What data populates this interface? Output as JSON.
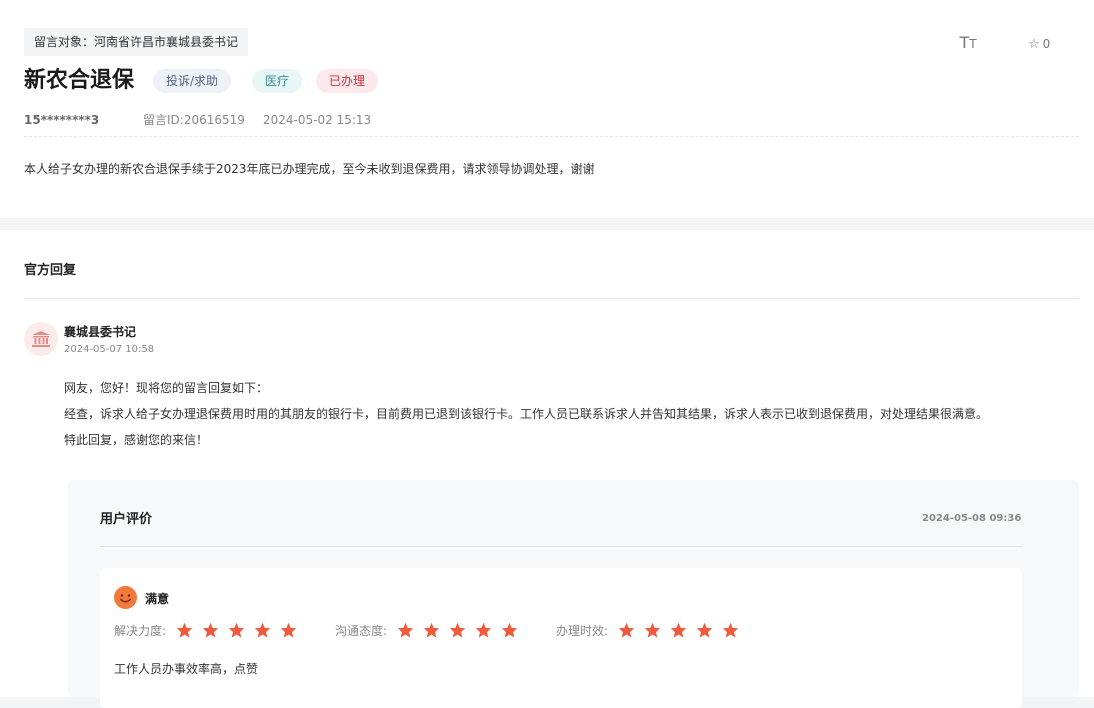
{
  "message": {
    "target_label": "留言对象：",
    "target_value": "河南省许昌市襄城县委书记",
    "title": "新农合退保",
    "tags": {
      "type": "投诉/求助",
      "category": "医疗",
      "status": "已办理"
    },
    "user": "15********3",
    "id_label": "留言ID:",
    "id_value": "20616519",
    "time": "2024-05-02 15:13",
    "content": "本人给子女办理的新农合退保手续于2023年底已办理完成，至今未收到退保费用，请求领导协调处理，谢谢",
    "font_size_icon": "text-size-icon",
    "favorite_count": "0"
  },
  "reply": {
    "section_title": "官方回复",
    "org_icon": "government-building-icon",
    "org_name": "襄城县委书记",
    "time": "2024-05-07 10:58",
    "lines": [
      "网友，您好！现将您的留言回复如下：",
      "经查，诉求人给子女办理退保费用时用的其朋友的银行卡，目前费用已退到该银行卡。工作人员已联系诉求人并告知其结果，诉求人表示已收到退保费用，对处理结果很满意。",
      "特此回复，感谢您的来信！"
    ]
  },
  "evaluation": {
    "title": "用户评价",
    "time": "2024-05-08 09:36",
    "satisfaction_icon": "smile-face-icon",
    "satisfaction": "满意",
    "ratings": [
      {
        "label": "解决力度:",
        "stars": 5
      },
      {
        "label": "沟通态度:",
        "stars": 5
      },
      {
        "label": "办理时效:",
        "stars": 5
      }
    ],
    "comment": "工作人员办事效率高，点赞"
  },
  "colors": {
    "star": "#f05a3c",
    "status_red": "#c9303f",
    "category_teal": "#3a8e91",
    "face_orange": "#f2793c"
  }
}
